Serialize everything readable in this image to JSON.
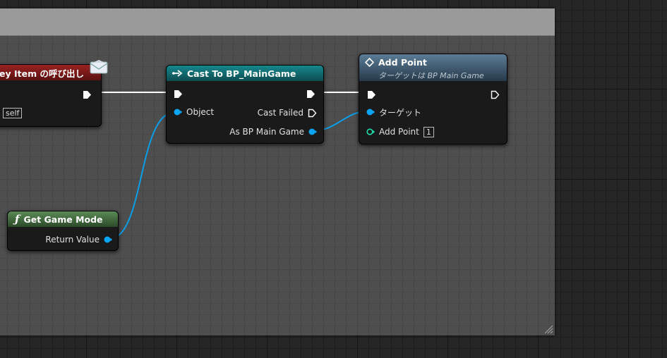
{
  "nodes": {
    "event_node": {
      "title": "ey Item の呼び出し",
      "self_label": "self",
      "icon": "envelope-icon"
    },
    "cast_node": {
      "title": "Cast To BP_MainGame",
      "icon": "cast-arrow-icon",
      "pins": {
        "object": "Object",
        "cast_failed": "Cast Failed",
        "as_bp_main_game": "As BP Main Game"
      }
    },
    "add_point_node": {
      "title": "Add Point",
      "subtitle": "ターゲットは BP Main Game",
      "icon": "diamond-icon",
      "pins": {
        "target": "ターゲット",
        "add_point": "Add Point",
        "add_point_value": "1"
      }
    },
    "get_game_mode_node": {
      "title": "Get Game Mode",
      "icon": "function-icon",
      "pins": {
        "return_value": "Return Value"
      }
    }
  },
  "colors": {
    "exec": "#ffffff",
    "object_pin": "#0aa5f5",
    "int_pin": "#1fe0a8",
    "cast_header": "#107a80",
    "function_header": "#4a7a44",
    "add_point_header": "#4d6a80",
    "event_header": "#8a1a1a"
  }
}
